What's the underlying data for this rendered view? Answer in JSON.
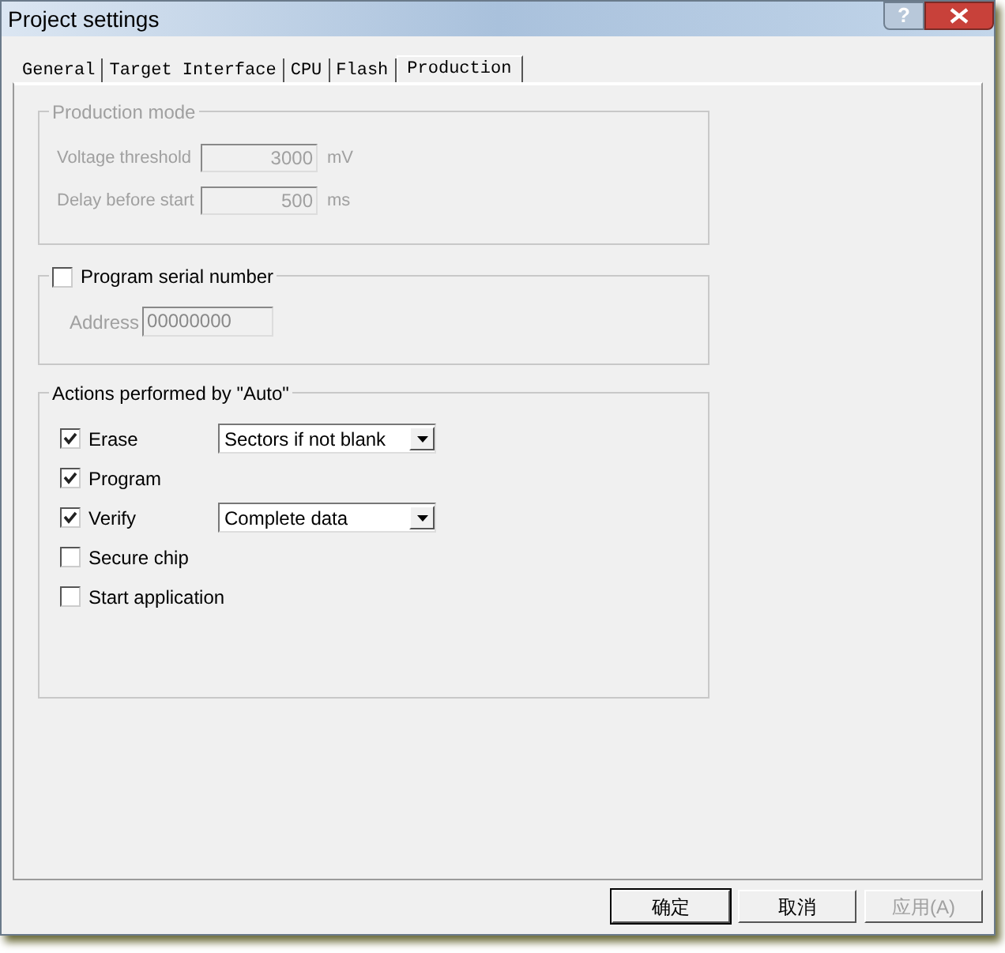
{
  "window": {
    "title": "Project settings",
    "help_button": "?"
  },
  "tabs": [
    {
      "label": "General",
      "selected": false
    },
    {
      "label": "Target Interface",
      "selected": false
    },
    {
      "label": "CPU",
      "selected": false
    },
    {
      "label": "Flash",
      "selected": false
    },
    {
      "label": "Production",
      "selected": true
    }
  ],
  "production_mode": {
    "title": "Production mode",
    "disabled": true,
    "fields": [
      {
        "label": "Voltage threshold",
        "value": "3000",
        "unit": "mV"
      },
      {
        "label": "Delay before start",
        "value": "500",
        "unit": "ms"
      }
    ]
  },
  "serial_number": {
    "label": "Program serial number",
    "checked": false,
    "address": {
      "label": "Address",
      "value": "00000000",
      "disabled": true
    }
  },
  "actions": {
    "title": "Actions performed by \"Auto\"",
    "items": [
      {
        "label": "Erase",
        "checked": true,
        "dropdown": "Sectors if not blank"
      },
      {
        "label": "Program",
        "checked": true
      },
      {
        "label": "Verify",
        "checked": true,
        "dropdown": "Complete data"
      },
      {
        "label": "Secure chip",
        "checked": false
      },
      {
        "label": "Start application",
        "checked": false
      }
    ]
  },
  "buttons": [
    {
      "label": "确定",
      "disabled": false,
      "default": true
    },
    {
      "label": "取消",
      "disabled": false,
      "default": false
    },
    {
      "label": "应用(A)",
      "disabled": true,
      "default": false
    }
  ]
}
